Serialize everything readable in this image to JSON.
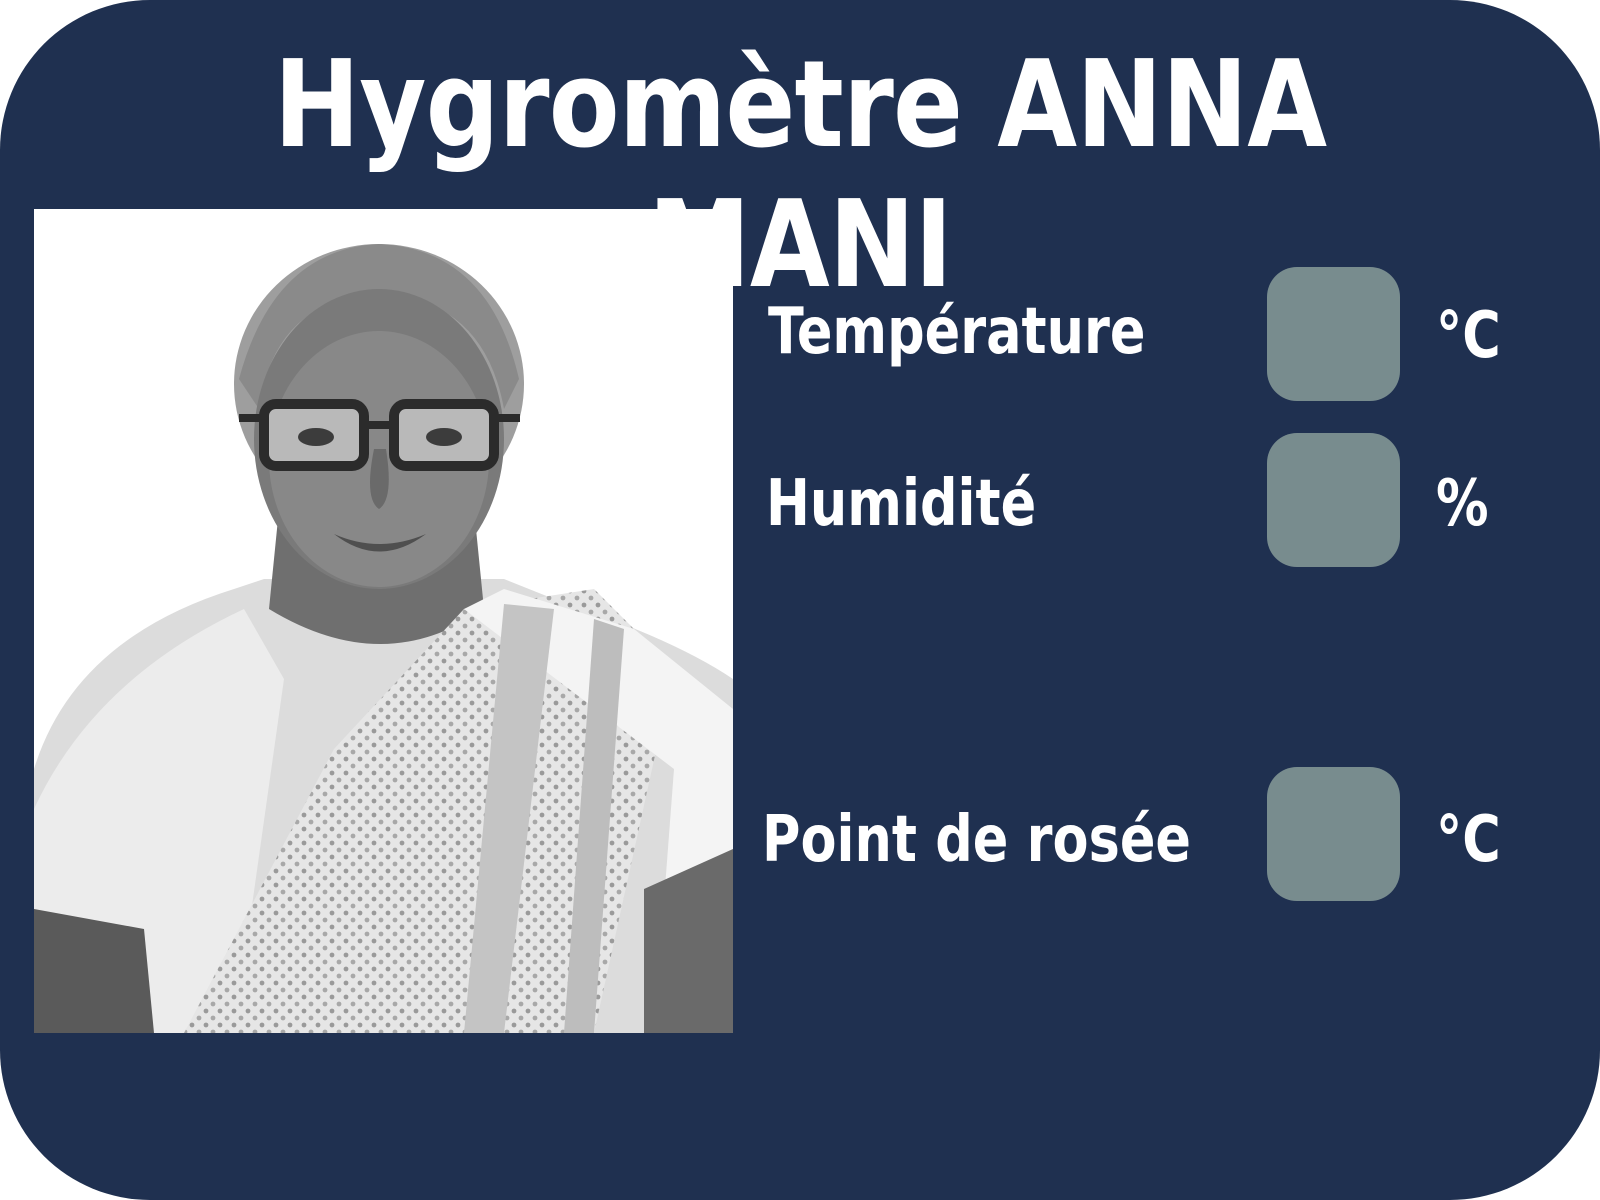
{
  "title": "Hygromètre ANNA MANI",
  "photo": {
    "alt": "Anna Mani"
  },
  "readings": {
    "temperature": {
      "label": "Température",
      "value": "",
      "unit": "°C"
    },
    "humidity": {
      "label": "Humidité",
      "value": "",
      "unit": "%"
    },
    "dew_point": {
      "label": "Point de rosée",
      "value": "",
      "unit": "°C"
    }
  },
  "colors": {
    "background": "#1f3050",
    "value_box": "#788c8e",
    "text": "#ffffff"
  }
}
